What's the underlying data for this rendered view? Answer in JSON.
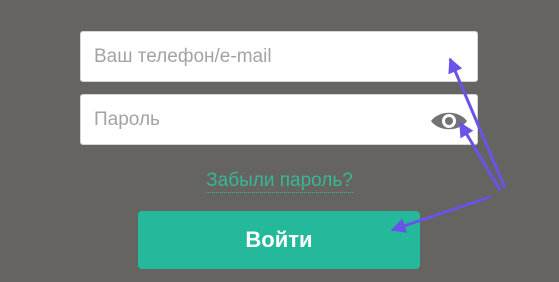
{
  "login_form": {
    "login_field": {
      "placeholder": "Ваш телефон/e-mail",
      "value": ""
    },
    "password_field": {
      "placeholder": "Пароль",
      "value": "",
      "toggle_icon": "eye-icon"
    },
    "forgot_password_label": "Забыли пароль?",
    "submit_label": "Войти"
  },
  "colors": {
    "background": "#656461",
    "accent": "#24b99a",
    "link": "#37b894",
    "annotation_arrow": "#6a53e8"
  }
}
